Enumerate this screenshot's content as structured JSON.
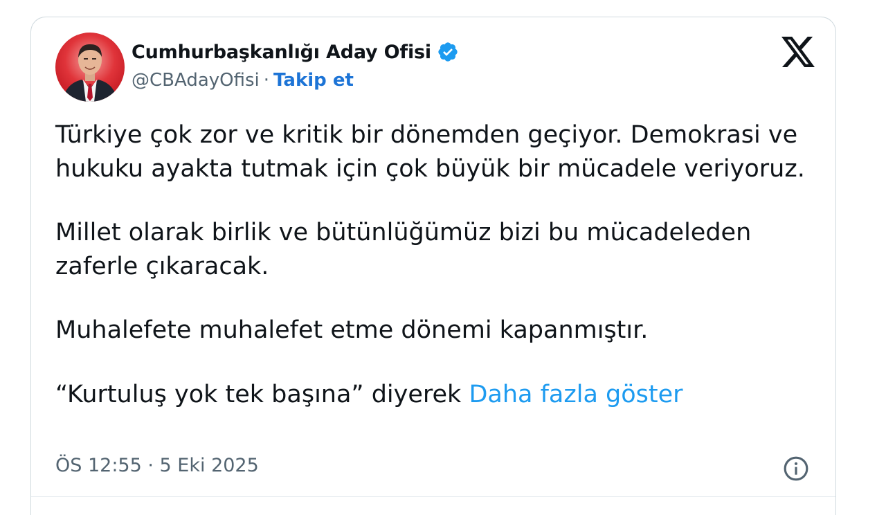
{
  "colors": {
    "text": "#0f1419",
    "secondary": "#536471",
    "link": "#1d9bf0",
    "follow": "#1d74d6",
    "verified": "#1d9bf0"
  },
  "author": {
    "display_name": "Cumhurbaşkanlığı Aday Ofisi",
    "handle": "@CBAdayOfisi",
    "separator": "·",
    "follow_label": "Takip et",
    "verified_icon": "verified-badge-icon",
    "avatar_icon": "profile-photo"
  },
  "platform_icon": "x-logo-icon",
  "tweet": {
    "para1": "Türkiye çok zor ve kritik bir dönemden geçiyor. Demokrasi ve hukuku ayakta tutmak için çok büyük bir mücadele veriyoruz.",
    "para2": "Millet olarak birlik ve bütünlüğümüz bizi bu mücadeleden zaferle çıkaracak.",
    "para3": "Muhalefete muhalefet etme dönemi kapanmıştır.",
    "para4_text": "“Kurtuluş yok tek başına” diyerek",
    "show_more": "Daha fazla göster"
  },
  "meta": {
    "timestamp": "ÖS 12:55 · 5 Eki 2025",
    "info_icon": "info-icon"
  }
}
